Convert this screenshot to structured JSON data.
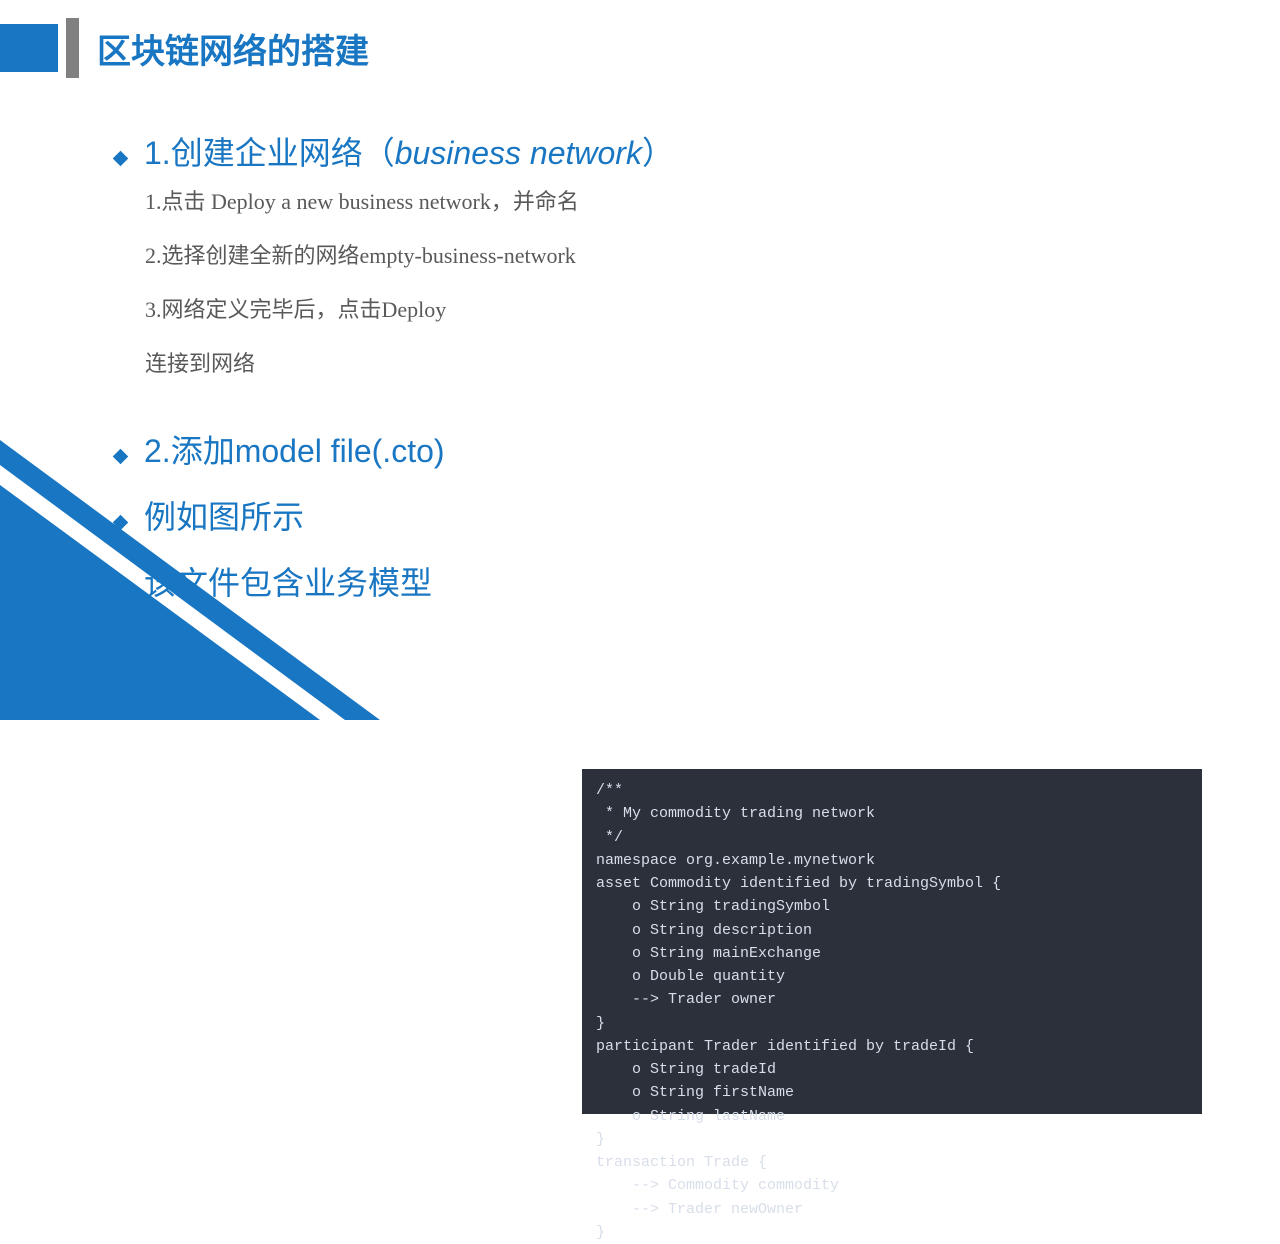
{
  "header": {
    "title": "区块链网络的搭建"
  },
  "bullets": [
    {
      "prefix": "1.创建企业网络（",
      "italic": "business network",
      "suffix": "）",
      "subs": [
        "1.点击 Deploy a new business network，并命名",
        "2.选择创建全新的网络empty-business-network",
        "3.网络定义完毕后，点击Deploy",
        "连接到网络"
      ]
    },
    {
      "text": "2.添加model file(.cto)"
    },
    {
      "text": "例如图所示"
    },
    {
      "text": "该文件包含业务模型"
    }
  ],
  "code": "/**\n * My commodity trading network\n */\nnamespace org.example.mynetwork\nasset Commodity identified by tradingSymbol {\n    o String tradingSymbol\n    o String description\n    o String mainExchange\n    o Double quantity\n    --> Trader owner\n}\nparticipant Trader identified by tradeId {\n    o String tradeId\n    o String firstName\n    o String lastName\n}\ntransaction Trade {\n    --> Commodity commodity\n    --> Trader newOwner\n}"
}
